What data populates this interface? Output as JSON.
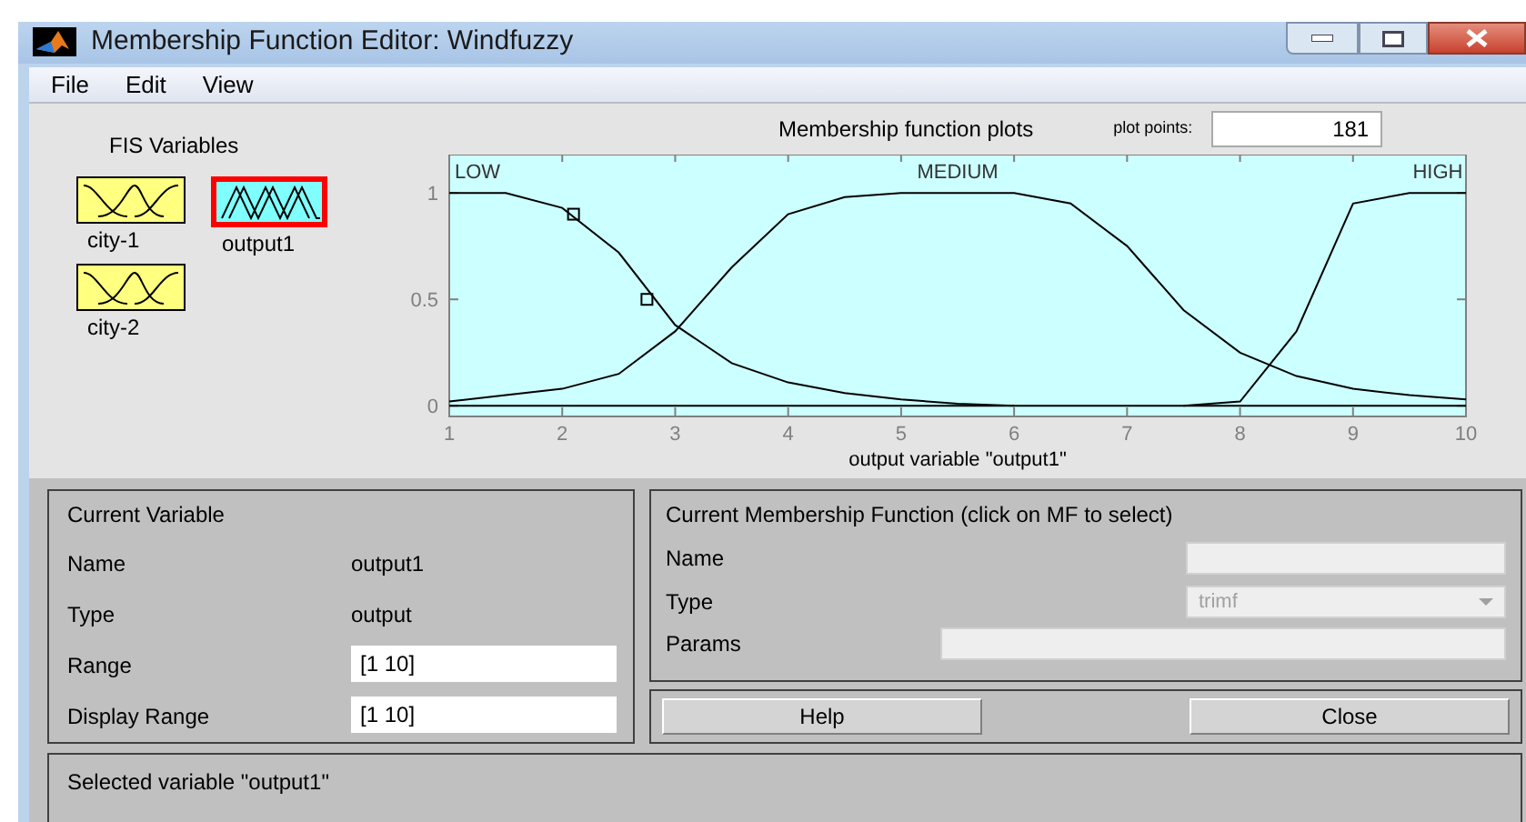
{
  "window": {
    "title": "Membership Function Editor: Windfuzzy"
  },
  "menu": [
    "File",
    "Edit",
    "View"
  ],
  "fis_variables": {
    "title": "FIS Variables",
    "items": [
      {
        "label": "city-1",
        "kind": "input",
        "selected": false
      },
      {
        "label": "output1",
        "kind": "output",
        "selected": true
      },
      {
        "label": "city-2",
        "kind": "input",
        "selected": false
      }
    ]
  },
  "plot": {
    "title": "Membership function plots",
    "plot_points_label": "plot points:",
    "plot_points": "181",
    "chart_data": {
      "type": "line",
      "xlabel": "output variable \"output1\"",
      "x": [
        1,
        1.5,
        2,
        2.5,
        3,
        3.5,
        4,
        4.5,
        5,
        5.5,
        6,
        6.5,
        7,
        7.5,
        8,
        8.5,
        9,
        9.5,
        10
      ],
      "series": [
        {
          "name": "LOW",
          "color": "#000000",
          "values": [
            1,
            1,
            0.93,
            0.72,
            0.38,
            0.2,
            0.11,
            0.06,
            0.03,
            0.01,
            0,
            null,
            null,
            null,
            null,
            null,
            null,
            null,
            null
          ]
        },
        {
          "name": "MEDIUM",
          "color": "#000000",
          "values": [
            0.02,
            0.05,
            0.08,
            0.15,
            0.35,
            0.65,
            0.9,
            0.98,
            1,
            1,
            1,
            0.95,
            0.75,
            0.45,
            0.25,
            0.14,
            0.08,
            0.05,
            0.03
          ]
        },
        {
          "name": "HIGH",
          "color": "#000000",
          "values": [
            null,
            null,
            null,
            null,
            null,
            null,
            null,
            null,
            null,
            null,
            null,
            null,
            null,
            0,
            0.02,
            0.35,
            0.95,
            1,
            1
          ]
        }
      ],
      "xlim": [
        1,
        10
      ],
      "ylim": [
        -0.05,
        1.18
      ],
      "xticks": [
        1,
        2,
        3,
        4,
        5,
        6,
        7,
        8,
        9,
        10
      ],
      "yticks": [
        0,
        0.5,
        1
      ]
    }
  },
  "current_variable": {
    "title": "Current Variable",
    "name_label": "Name",
    "name": "output1",
    "type_label": "Type",
    "type": "output",
    "range_label": "Range",
    "range": "[1 10]",
    "display_range_label": "Display Range",
    "display_range": "[1 10]"
  },
  "current_mf": {
    "title": "Current Membership Function (click on MF to select)",
    "name_label": "Name",
    "type_label": "Type",
    "type": "trimf",
    "params_label": "Params",
    "disabled": true
  },
  "buttons": [
    "Help",
    "Close"
  ],
  "status": "Selected variable \"output1\""
}
